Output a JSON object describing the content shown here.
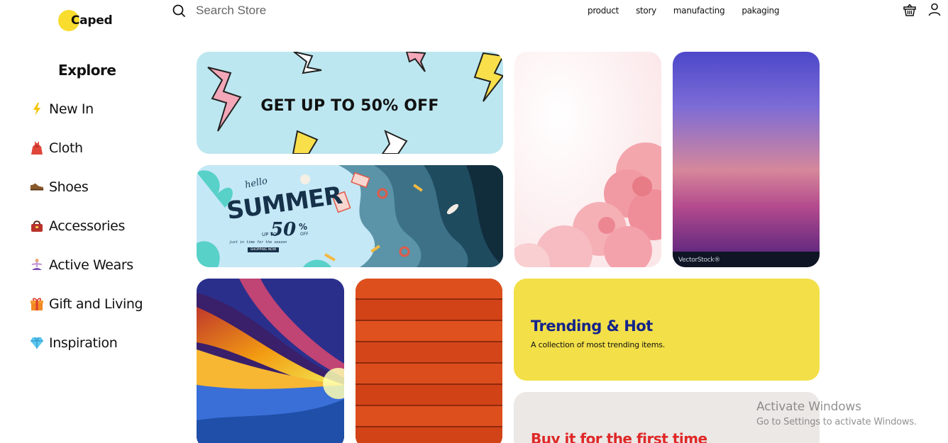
{
  "brand": {
    "name": "Caped",
    "accent": "#f8dc2e"
  },
  "search": {
    "placeholder": "Search Store"
  },
  "topnav": [
    {
      "label": "product"
    },
    {
      "label": "story"
    },
    {
      "label": "manufacting"
    },
    {
      "label": "pakaging"
    }
  ],
  "header_icons": [
    "basket-icon",
    "user-icon"
  ],
  "sidebar": {
    "title": "Explore",
    "items": [
      {
        "label": "New In",
        "icon": "lightning-icon"
      },
      {
        "label": "Cloth",
        "icon": "dress-icon"
      },
      {
        "label": "Shoes",
        "icon": "shoe-icon"
      },
      {
        "label": "Accessories",
        "icon": "handbag-icon"
      },
      {
        "label": "Active Wears",
        "icon": "yoga-icon"
      },
      {
        "label": "Gift and Living",
        "icon": "gift-icon"
      },
      {
        "label": "Inspiration",
        "icon": "gem-icon"
      }
    ]
  },
  "cards": {
    "sale": {
      "headline": "GET UP TO 50% OFF"
    },
    "summer": {
      "hello": "hello",
      "title": "SUMMER",
      "up_to": "UP TO",
      "percent": "50",
      "percent_sign": "%",
      "off": "OFF",
      "tagline": "just in time for the season",
      "cta": "SHOPPING NOW"
    },
    "gradient": {
      "watermark": "VectorStock®"
    },
    "trending": {
      "title": "Trending & Hot",
      "subtitle": "A collection of most trending items.",
      "title_color": "#14248a"
    },
    "first_time": {
      "title": "Buy it for the first time",
      "title_color": "#e02828"
    }
  },
  "os_watermark": {
    "line1": "Activate Windows",
    "line2": "Go to Settings to activate Windows."
  }
}
